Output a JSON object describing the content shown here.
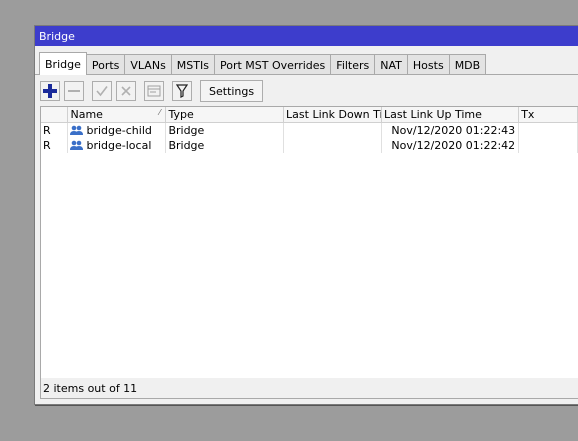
{
  "window": {
    "title": "Bridge"
  },
  "tabs": [
    {
      "label": "Bridge",
      "active": true
    },
    {
      "label": "Ports"
    },
    {
      "label": "VLANs"
    },
    {
      "label": "MSTIs"
    },
    {
      "label": "Port MST Overrides"
    },
    {
      "label": "Filters"
    },
    {
      "label": "NAT"
    },
    {
      "label": "Hosts"
    },
    {
      "label": "MDB"
    }
  ],
  "toolbar": {
    "add_icon": "plus-icon",
    "remove_icon": "minus-icon",
    "enable_icon": "check-icon",
    "disable_icon": "x-icon",
    "comment_icon": "comment-icon",
    "filter_icon": "filter-icon",
    "settings_label": "Settings"
  },
  "table": {
    "columns": {
      "flag": "",
      "name": "Name",
      "type": "Type",
      "last_link_down": "Last Link Down Ti...",
      "last_link_up": "Last Link Up Time",
      "tx": "Tx"
    },
    "rows": [
      {
        "flag": "R",
        "name": "bridge-child",
        "type": "Bridge",
        "last_link_down": "",
        "last_link_up": "Nov/12/2020 01:22:43",
        "tx": ""
      },
      {
        "flag": "R",
        "name": "bridge-local",
        "type": "Bridge",
        "last_link_down": "",
        "last_link_up": "Nov/12/2020 01:22:42",
        "tx": ""
      }
    ]
  },
  "status": {
    "text": "2 items out of 11"
  },
  "colors": {
    "titlebar": "#3d3dcc",
    "add_icon": "#1a2a9a",
    "bridge_icon": "#3a6fc8"
  }
}
